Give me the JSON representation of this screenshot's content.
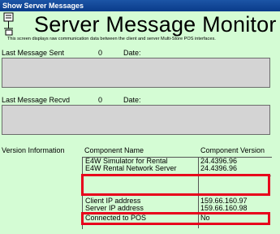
{
  "window": {
    "title": "Show Server Messages"
  },
  "header": {
    "title": "Server Message Monitor",
    "subtitle": "This screen displays raw communication data between the client and server Multi-Store POS interfaces."
  },
  "last_sent": {
    "label": "Last Message Sent",
    "count": "0",
    "date_label": "Date:"
  },
  "last_recvd": {
    "label": "Last Message Recvd",
    "count": "0",
    "date_label": "Date:"
  },
  "version_info": {
    "label": "Version Information",
    "columns": [
      "Component Name",
      "Component Version"
    ],
    "rows": [
      {
        "name": "E4W Simulator for Rental",
        "version": "24.4396.96"
      },
      {
        "name": "E4W Rental Network Server",
        "version": "24.4396.96"
      },
      {
        "name": "",
        "version": ""
      },
      {
        "name": "Client IP address",
        "version": "159.66.160.97"
      },
      {
        "name": "Server IP address",
        "version": "159.66.160.98"
      },
      {
        "name": "Connected to POS",
        "version": "No"
      }
    ]
  },
  "colors": {
    "background": "#d4fcd4",
    "titlebar": "#0a3b8a",
    "highlight": "#e8001c"
  }
}
